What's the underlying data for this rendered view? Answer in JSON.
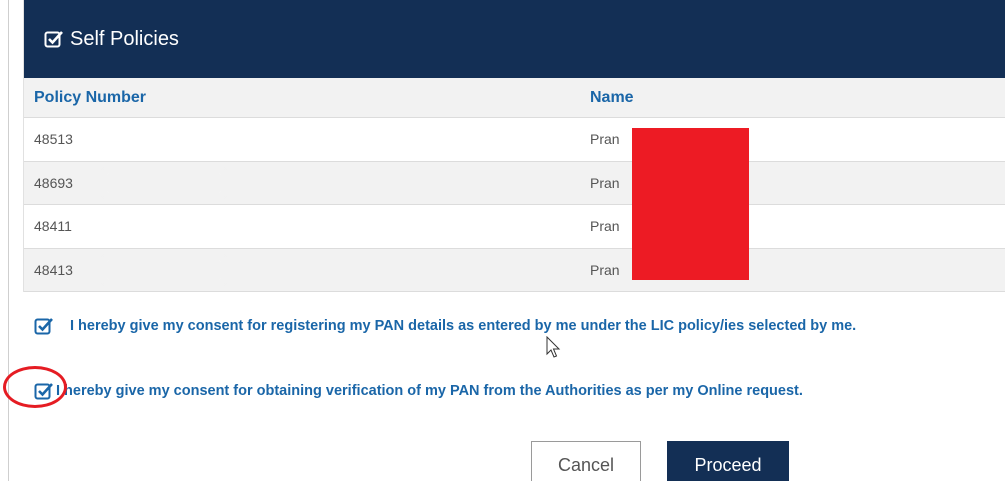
{
  "panel": {
    "title": "Self Policies",
    "header_icon": "checkbox-checked-icon"
  },
  "table": {
    "columns": [
      "Policy Number",
      "Name"
    ],
    "rows": [
      {
        "policy_number": "48513",
        "name": "Pran"
      },
      {
        "policy_number": "48693",
        "name": "Pran"
      },
      {
        "policy_number": "48411",
        "name": "Pran"
      },
      {
        "policy_number": "48413",
        "name": "Pran"
      }
    ]
  },
  "consents": [
    {
      "text": "I hereby give my consent for registering my PAN details as entered by me under the LIC policy/ies selected by me.",
      "checked": true
    },
    {
      "text": "I hereby give my consent for obtaining verification of my PAN from the Authorities as per my Online request.",
      "checked": true
    }
  ],
  "buttons": {
    "cancel": "Cancel",
    "proceed": "Proceed"
  },
  "colors": {
    "header_bg": "#132f55",
    "accent_text": "#1a66a8",
    "redaction": "#ed1b24",
    "highlight_circle": "#e51c23"
  }
}
